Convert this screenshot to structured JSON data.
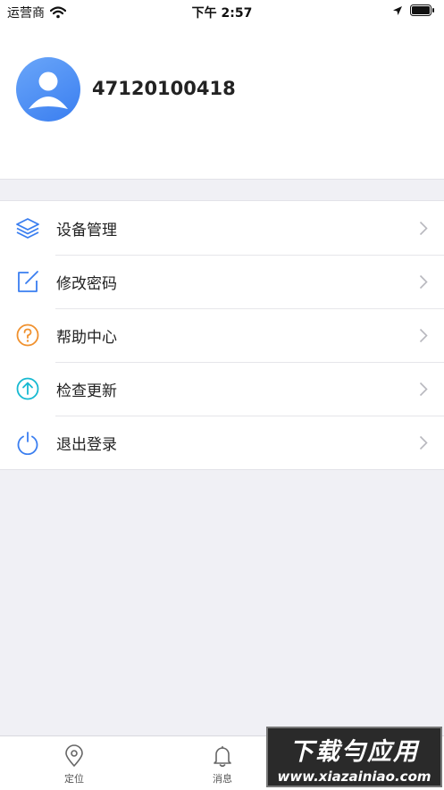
{
  "status_bar": {
    "carrier": "运营商",
    "time": "下午 2:57"
  },
  "profile": {
    "username": "47120100418",
    "avatar_icon": "user-avatar-icon"
  },
  "colors": {
    "accent": "#3a7ef0",
    "orange": "#f0912e",
    "teal": "#17b9d1",
    "background": "#f0f0f5"
  },
  "menu": {
    "items": [
      {
        "label": "设备管理",
        "icon": "layers-icon"
      },
      {
        "label": "修改密码",
        "icon": "edit-icon"
      },
      {
        "label": "帮助中心",
        "icon": "help-icon"
      },
      {
        "label": "检查更新",
        "icon": "upload-icon"
      },
      {
        "label": "退出登录",
        "icon": "power-icon"
      }
    ]
  },
  "tab_bar": {
    "tabs": [
      {
        "label": "定位",
        "icon": "location-pin-icon"
      },
      {
        "label": "消息",
        "icon": "bell-icon"
      }
    ]
  },
  "watermark": {
    "title": "下载勻应用",
    "url": "www.xiazainiao.com"
  }
}
